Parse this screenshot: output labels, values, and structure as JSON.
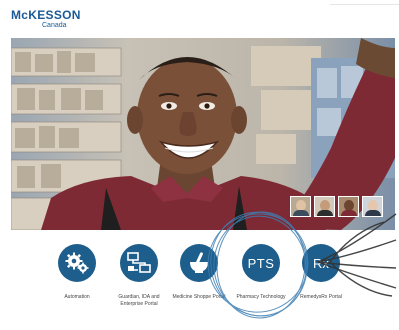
{
  "brand": {
    "name_main": "McKESSON",
    "name_sub": "Canada"
  },
  "hero": {
    "alt": "hero-photo-smiling-pharmacy-worker"
  },
  "thumbnails": [
    {
      "icon": "person-thumb-1"
    },
    {
      "icon": "person-thumb-2"
    },
    {
      "icon": "person-thumb-3"
    },
    {
      "icon": "person-thumb-4"
    }
  ],
  "portals": [
    {
      "label": "Automation",
      "icon": "gears-icon"
    },
    {
      "label": "Guardian, IDA and Enterprise Portal",
      "icon": "monitors-icon"
    },
    {
      "label": "Medicine Shoppe Portal",
      "icon": "mortar-pestle-icon"
    },
    {
      "label": "Pharmacy Technology",
      "icon_text": "PTS"
    },
    {
      "label": "RemedysRx Portal",
      "icon_text": "Rx"
    }
  ],
  "colors": {
    "brand_blue": "#1b5a96",
    "icon_blue": "#1e5e8c",
    "annotation_circle": "#3f7fb3",
    "annotation_arrow": "#333333"
  }
}
